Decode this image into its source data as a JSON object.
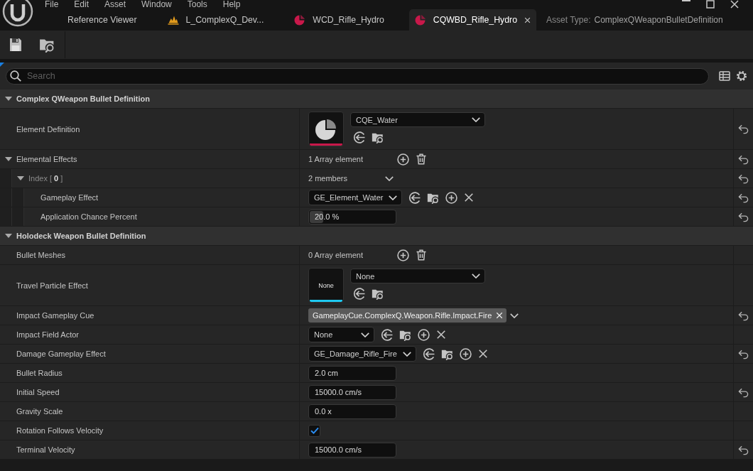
{
  "menu": [
    "File",
    "Edit",
    "Asset",
    "Window",
    "Tools",
    "Help"
  ],
  "tabs": [
    {
      "label": "Reference Viewer",
      "kind": "plain",
      "selected": false
    },
    {
      "label": "L_ComplexQ_Dev...",
      "kind": "level",
      "selected": false
    },
    {
      "label": "WCD_Rifle_Hydro",
      "kind": "asset",
      "selected": false
    },
    {
      "label": "CQWBD_Rifle_Hydro",
      "kind": "asset",
      "selected": true
    }
  ],
  "asset_type": {
    "label": "Asset Type:",
    "value": "ComplexQWeaponBulletDefinition"
  },
  "search": {
    "placeholder": "Search"
  },
  "categories": [
    {
      "title": "Complex QWeapon Bullet Definition",
      "expanded": true,
      "properties": [
        {
          "label": "Element Definition",
          "kind": "asset",
          "value": "CQE_Water",
          "thumbnail": {
            "kind": "pie",
            "color": "#c8184a"
          },
          "has_reset": true
        },
        {
          "label": "Elemental Effects",
          "kind": "array",
          "value": "1 Array element",
          "expanded": true,
          "has_reset": true,
          "children": [
            {
              "label": "Index [ **0** ]",
              "kind": "struct",
              "value": "2 members",
              "expanded": true,
              "has_reset": true,
              "children": [
                {
                  "label": "Gameplay Effect",
                  "kind": "class",
                  "value": "GE_Element_Water",
                  "has_reset": true
                },
                {
                  "label": "Application Chance Percent",
                  "kind": "number",
                  "value": "20.0 %",
                  "level": 0.17,
                  "has_reset": true
                }
              ]
            }
          ]
        }
      ]
    },
    {
      "title": "Holodeck Weapon Bullet Definition",
      "expanded": true,
      "properties": [
        {
          "label": "Bullet Meshes",
          "kind": "array",
          "value": "0 Array element",
          "has_reset": false
        },
        {
          "label": "Travel Particle Effect",
          "kind": "asset",
          "value": "None",
          "thumbnail": {
            "kind": "text",
            "text": "None",
            "color": "#1ec8f0"
          },
          "has_reset": false
        },
        {
          "label": "Impact Gameplay Cue",
          "kind": "tag",
          "value": "GameplayCue.ComplexQ.Weapon.Rifle.Impact.Fire",
          "has_reset": true
        },
        {
          "label": "Impact Field Actor",
          "kind": "class",
          "value": "None",
          "has_reset": false
        },
        {
          "label": "Damage Gameplay Effect",
          "kind": "class",
          "value": "GE_Damage_Rifle_Fire",
          "has_reset": true
        },
        {
          "label": "Bullet Radius",
          "kind": "number",
          "value": "2.0 cm",
          "has_reset": false
        },
        {
          "label": "Initial Speed",
          "kind": "number",
          "value": "15000.0 cm/s",
          "has_reset": true
        },
        {
          "label": "Gravity Scale",
          "kind": "number",
          "value": "0.0 x",
          "has_reset": false
        },
        {
          "label": "Rotation Follows Velocity",
          "kind": "checkbox",
          "checked": true,
          "has_reset": false
        },
        {
          "label": "Terminal Velocity",
          "kind": "number",
          "value": "15000.0 cm/s",
          "has_reset": true
        }
      ]
    }
  ]
}
